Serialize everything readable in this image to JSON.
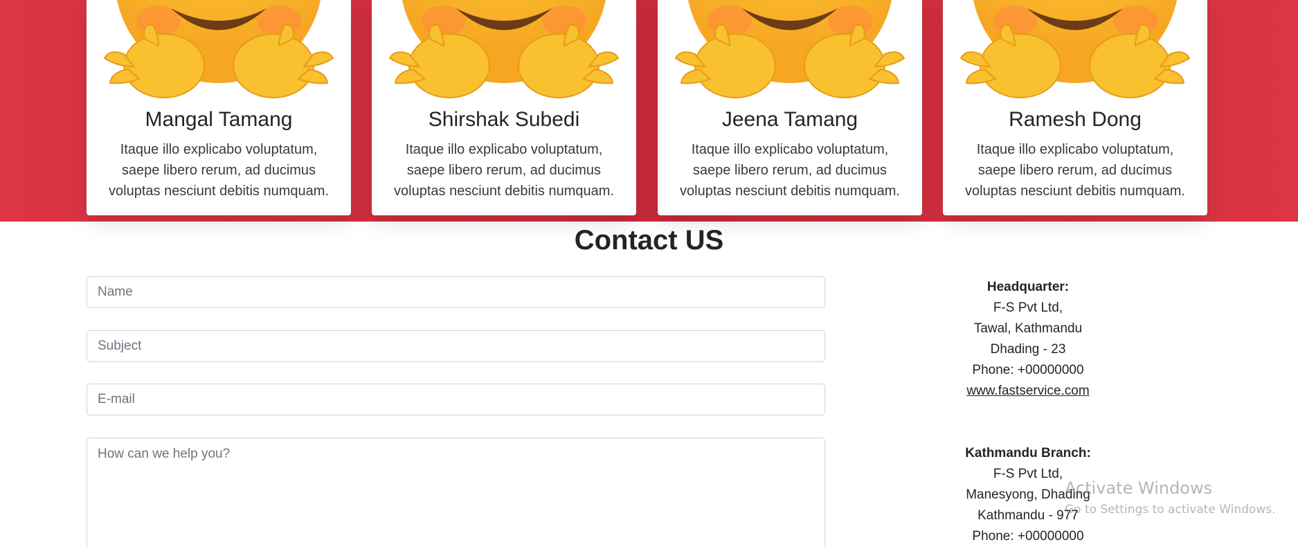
{
  "team": {
    "members": [
      {
        "name": "Mangal Tamang",
        "description": "Itaque illo explicabo voluptatum, saepe libero rerum, ad ducimus voluptas nesciunt debitis numquam.",
        "icon": "hugging-face-emoji-icon"
      },
      {
        "name": "Shirshak Subedi",
        "description": "Itaque illo explicabo voluptatum, saepe libero rerum, ad ducimus voluptas nesciunt debitis numquam.",
        "icon": "hugging-face-emoji-icon"
      },
      {
        "name": "Jeena Tamang",
        "description": "Itaque illo explicabo voluptatum, saepe libero rerum, ad ducimus voluptas nesciunt debitis numquam.",
        "icon": "hugging-face-emoji-icon"
      },
      {
        "name": "Ramesh Dong",
        "description": "Itaque illo explicabo voluptatum, saepe libero rerum, ad ducimus voluptas nesciunt debitis numquam.",
        "icon": "hugging-face-emoji-icon"
      }
    ],
    "band_color": "#dc3545"
  },
  "contact": {
    "title": "Contact US",
    "form": {
      "name_placeholder": "Name",
      "name_value": "",
      "subject_placeholder": "Subject",
      "subject_value": "",
      "email_placeholder": "E-mail",
      "email_value": "",
      "message_placeholder": "How can we help you?",
      "message_value": ""
    },
    "headquarter": {
      "label": "Headquarter:",
      "line1": "F-S Pvt Ltd,",
      "line2": "Tawal, Kathmandu",
      "line3": "Dhading - 23",
      "phone": "Phone: +00000000",
      "website": "www.fastservice.com"
    },
    "branch": {
      "label": "Kathmandu Branch:",
      "line1": "F-S Pvt Ltd,",
      "line2": "Manesyong, Dhading",
      "line3": "Kathmandu - 977",
      "phone": "Phone: +00000000"
    }
  },
  "watermark": {
    "title": "Activate Windows",
    "subtitle": "Go to Settings to activate Windows."
  }
}
